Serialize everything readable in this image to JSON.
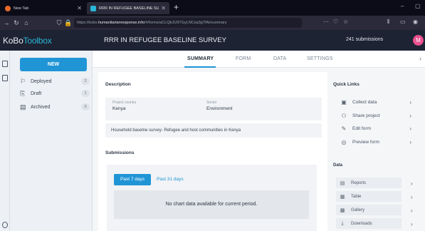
{
  "browser": {
    "tabs": [
      {
        "title": "New Tab"
      },
      {
        "title": "RRR IN REFUGEE BASELINE SU..."
      }
    ],
    "url_prefix": "https://kobo.",
    "url_host": "humanitarianresponse.info",
    "url_path": "/#/forms/aCLQbJU9TGyLNCsq3gTfAi/summary",
    "url_more": "···"
  },
  "app": {
    "logo_main": "KoBo",
    "logo_accent": "Toolbox",
    "project_title": "RRR IN REFUGEE BASELINE SURVEY",
    "submissions_count": "241 submissions",
    "avatar_initial": "M"
  },
  "sidebar": {
    "new_label": "NEW",
    "items": [
      {
        "label": "Deployed",
        "count": "2",
        "icon": "deploy-icon"
      },
      {
        "label": "Draft",
        "count": "1",
        "icon": "draft-icon"
      },
      {
        "label": "Archived",
        "count": "0",
        "icon": "archive-icon"
      }
    ]
  },
  "form_tabs": [
    "SUMMARY",
    "FORM",
    "DATA",
    "SETTINGS"
  ],
  "description": {
    "title": "Description",
    "country_label": "Project country",
    "country_value": "Kenya",
    "sector_label": "Sector",
    "sector_value": "Environment",
    "text": "Household baselne survey- Refugee and host communities in Kenya"
  },
  "submissions": {
    "title": "Submissions",
    "range_active": "Past 7 days",
    "range_other": "Past 31 days",
    "empty_message": "No chart data available for current period."
  },
  "quick_links": {
    "title": "Quick Links",
    "items": [
      {
        "label": "Collect data",
        "icon": "clipboard-icon"
      },
      {
        "label": "Share project",
        "icon": "share-user-icon"
      },
      {
        "label": "Edit form",
        "icon": "pencil-icon"
      },
      {
        "label": "Preview form",
        "icon": "eye-icon"
      }
    ]
  },
  "data_links": {
    "title": "Data",
    "items": [
      {
        "label": "Reports",
        "icon": "reports-icon"
      },
      {
        "label": "Table",
        "icon": "table-icon"
      },
      {
        "label": "Gallery",
        "icon": "gallery-icon"
      },
      {
        "label": "Downloads",
        "icon": "download-icon"
      }
    ]
  },
  "colors": {
    "accent": "#2095d6",
    "header_bg": "#1d2333",
    "avatar": "#e9508f"
  }
}
